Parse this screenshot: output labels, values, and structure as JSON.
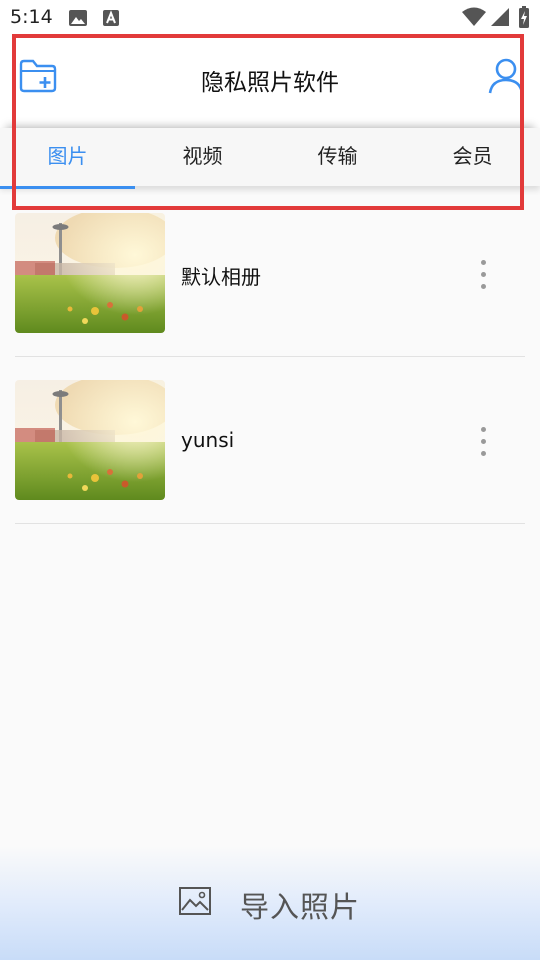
{
  "status_bar": {
    "time": "5:14",
    "icons": [
      "image-icon",
      "text-a-icon",
      "wifi-icon",
      "signal-icon",
      "battery-charging-icon"
    ]
  },
  "header": {
    "title": "隐私照片软件",
    "left_icon": "folder-add-icon",
    "right_icon": "user-icon"
  },
  "tabs": [
    {
      "label": "图片",
      "active": true
    },
    {
      "label": "视频",
      "active": false
    },
    {
      "label": "传输",
      "active": false
    },
    {
      "label": "会员",
      "active": false
    }
  ],
  "albums": [
    {
      "name": "默认相册",
      "thumbnail": "autumn-park-photo"
    },
    {
      "name": "yunsi",
      "thumbnail": "autumn-park-photo"
    }
  ],
  "import_bar": {
    "label": "导入照片",
    "icon": "image-frame-icon"
  },
  "colors": {
    "accent": "#3b8ff0",
    "highlight": "#e23a3a"
  }
}
